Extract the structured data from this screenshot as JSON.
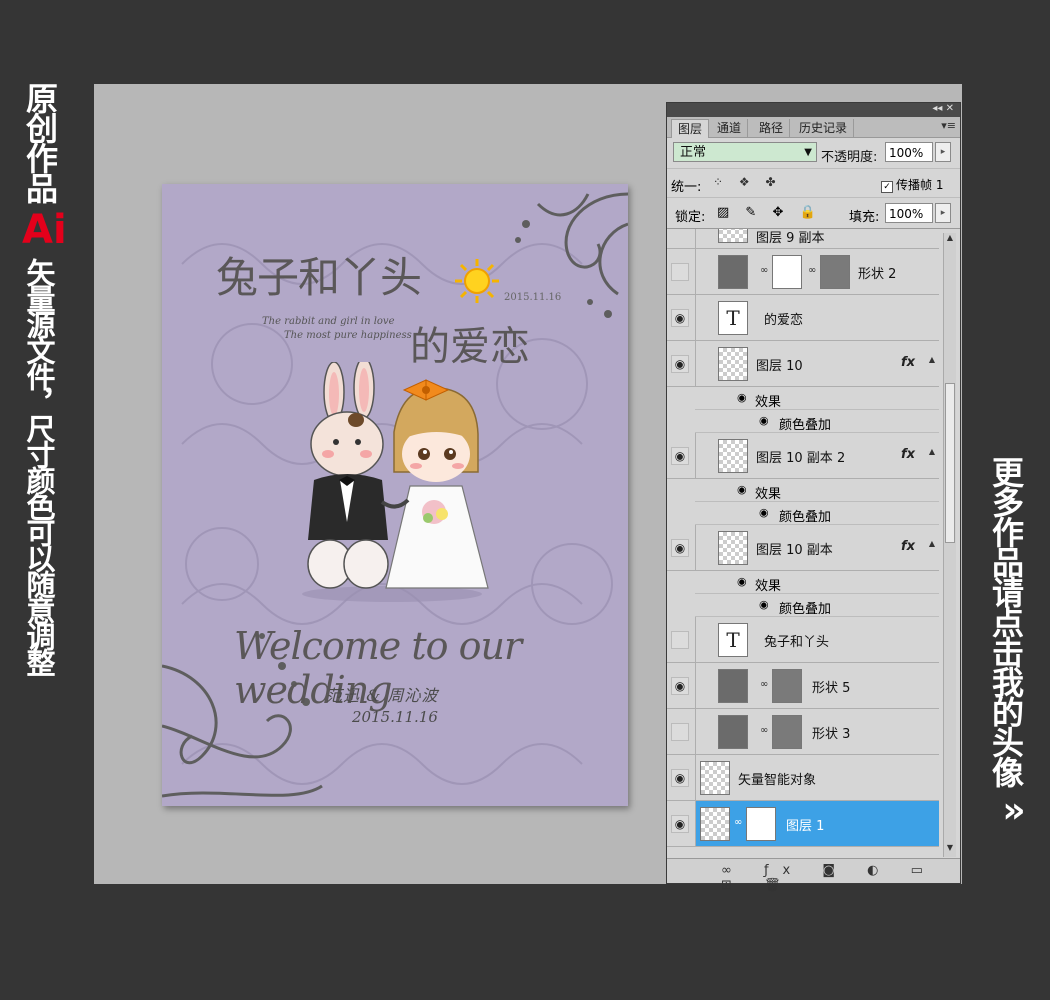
{
  "left_banner": {
    "line1": "原创作品",
    "ai": "Ai",
    "line2": "矢量源文件，尺寸颜色可以随意调整"
  },
  "right_banner": {
    "text": "更多作品请点击我的头像",
    "arrow": "»"
  },
  "artboard": {
    "title1": "兔子和丫头",
    "date1": "2015.11.16",
    "subtitle1": "The rabbit and girl in love",
    "subtitle2": "The most pure happiness",
    "title2": "的爱恋",
    "welcome": "Welcome to our wedding",
    "names": "范迅 & 周沁波",
    "date2": "2015.11.16"
  },
  "panel": {
    "tabs": [
      "图层",
      "通道",
      "路径",
      "历史记录"
    ],
    "blend_mode": "正常",
    "opacity_label": "不透明度:",
    "opacity_value": "100%",
    "unify_label": "统一:",
    "propagate_label": "传播帧",
    "propagate_value": "1",
    "lock_label": "锁定:",
    "fill_label": "填充:",
    "fill_value": "100%",
    "layers": {
      "partial": "图层 9 副本",
      "shape2": "形状 2",
      "text_love": "的爱恋",
      "layer10": "图层 10",
      "effects": "效果",
      "color_overlay": "颜色叠加",
      "layer10_copy2": "图层 10 副本 2",
      "layer10_copy": "图层 10 副本",
      "text_title": "兔子和丫头",
      "shape5": "形状 5",
      "shape3": "形状 3",
      "smart_object": "矢量智能对象",
      "layer1": "图层 1"
    },
    "fx_label": "fx"
  },
  "colors": {
    "artboard_bg": "#b2a8c8",
    "selected_layer": "#3da1e6",
    "ai_red": "#e4001b",
    "blend_green": "#cde8d0"
  }
}
